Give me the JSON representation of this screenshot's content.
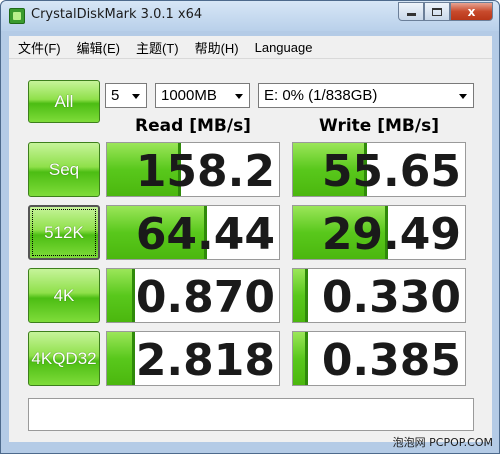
{
  "window": {
    "title": "CrystalDiskMark 3.0.1 x64",
    "close_label": "x"
  },
  "menu": [
    "文件(F)",
    "编辑(E)",
    "主题(T)",
    "帮助(H)",
    "Language"
  ],
  "controls": {
    "all_button": "All",
    "test_count": "5",
    "test_size": "1000MB",
    "drive": "E: 0% (1/838GB)"
  },
  "headers": {
    "read": "Read [MB/s]",
    "write": "Write [MB/s]"
  },
  "rows": [
    {
      "label": "Seq",
      "read": "158.2",
      "write": "55.65",
      "read_fill": 0.43,
      "write_fill": 0.43
    },
    {
      "label": "512K",
      "read": "64.44",
      "write": "29.49",
      "read_fill": 0.58,
      "write_fill": 0.55
    },
    {
      "label": "4K",
      "read": "0.870",
      "write": "0.330",
      "read_fill": 0.16,
      "write_fill": 0.09
    },
    {
      "label": "4K\nQD32",
      "read": "2.818",
      "write": "0.385",
      "read_fill": 0.16,
      "write_fill": 0.09
    }
  ],
  "comment": "",
  "watermark": "泡泡网 PCPOP.COM",
  "colors": {
    "accent": "#59c81c",
    "frame": "#b4cbe6"
  }
}
